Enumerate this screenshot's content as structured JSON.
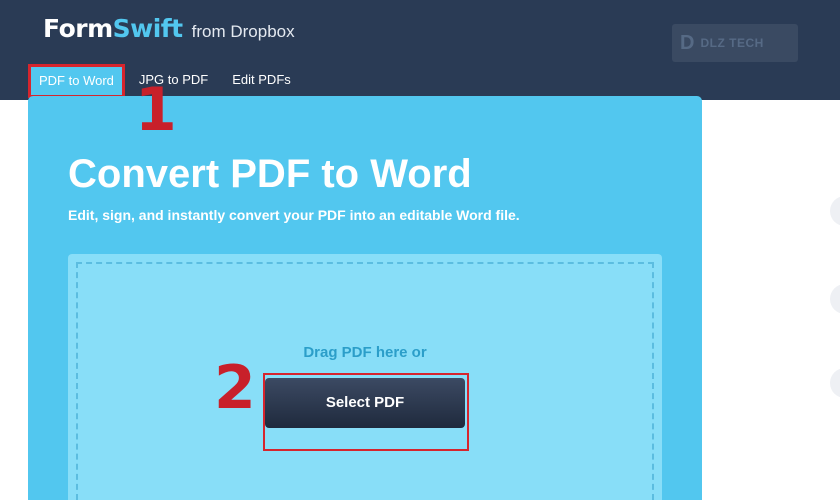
{
  "brand": {
    "logo_form": "Form",
    "logo_swift": "Swift",
    "logo_from": "from Dropbox"
  },
  "watermark": {
    "letter": "D",
    "text": "DLZ TECH"
  },
  "nav": {
    "items": [
      {
        "label": "PDF to Word",
        "active": true
      },
      {
        "label": "JPG to PDF",
        "active": false
      },
      {
        "label": "Edit PDFs",
        "active": false
      }
    ]
  },
  "annotations": {
    "step1": "1",
    "step2": "2"
  },
  "hero": {
    "title": "Convert PDF to Word",
    "subtitle": "Edit, sign, and instantly convert your PDF into an editable Word file.",
    "drop_text": "Drag PDF here or",
    "button_label": "Select PDF"
  },
  "colors": {
    "header": "#2a3b55",
    "accent": "#52c7ef",
    "highlight": "#d6252d",
    "button": "#1f2a3d"
  }
}
